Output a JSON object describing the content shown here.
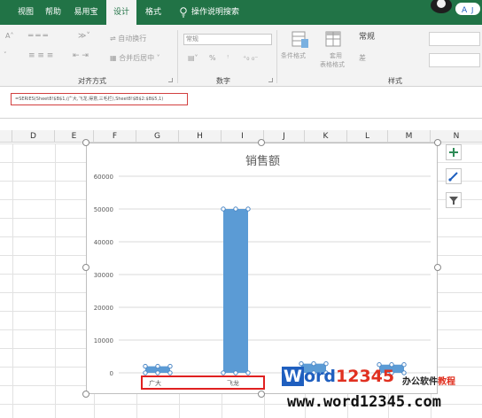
{
  "ribbon_tabs": [
    "视图",
    "帮助",
    "易用宝",
    "设计",
    "格式"
  ],
  "active_tab": "设计",
  "tell_me": "操作说明搜索",
  "ribbon": {
    "wrap_text": "自动换行",
    "merge_center": "合并后居中",
    "number_format": "常规",
    "percent": "%",
    "conditional_format": "条件格式",
    "format_as_table_1": "套用",
    "format_as_table_2": "表格格式",
    "style_normal": "常规",
    "style_bad": "差",
    "groups": {
      "alignment": "对齐方式",
      "number": "数字",
      "styles": "样式"
    }
  },
  "formula": "=SERIES(Sheet8!$B$1,(广大,飞龙,得意,三毛栏),Sheet8!$B$2:$B$5,1)",
  "columns": [
    "D",
    "E",
    "F",
    "G",
    "H",
    "I",
    "J",
    "K",
    "L",
    "M",
    "N"
  ],
  "chart_data": {
    "type": "bar",
    "title": "销售额",
    "categories": [
      "广大",
      "飞龙",
      "",
      ""
    ],
    "values": [
      2000,
      50000,
      2800,
      2500
    ],
    "ylim": [
      0,
      60000
    ],
    "yticks": [
      0,
      10000,
      20000,
      30000,
      40000,
      50000,
      60000
    ],
    "ytick_labels": [
      "0",
      "10000",
      "20000",
      "30000",
      "40000",
      "50000",
      "60000"
    ],
    "grid": true,
    "bar_color": "#5b9bd5",
    "legend": "none"
  },
  "chart_side_buttons": [
    "plus-icon",
    "brush-icon",
    "filter-icon"
  ],
  "watermark": {
    "logo_w": "W",
    "logo_ord": "ord",
    "logo_num": "12345",
    "tagline_a": "办公软件",
    "tagline_b": "教程",
    "url": "www.word12345.com"
  },
  "colors": {
    "excel_green": "#217346",
    "highlight_red": "#e02020"
  }
}
